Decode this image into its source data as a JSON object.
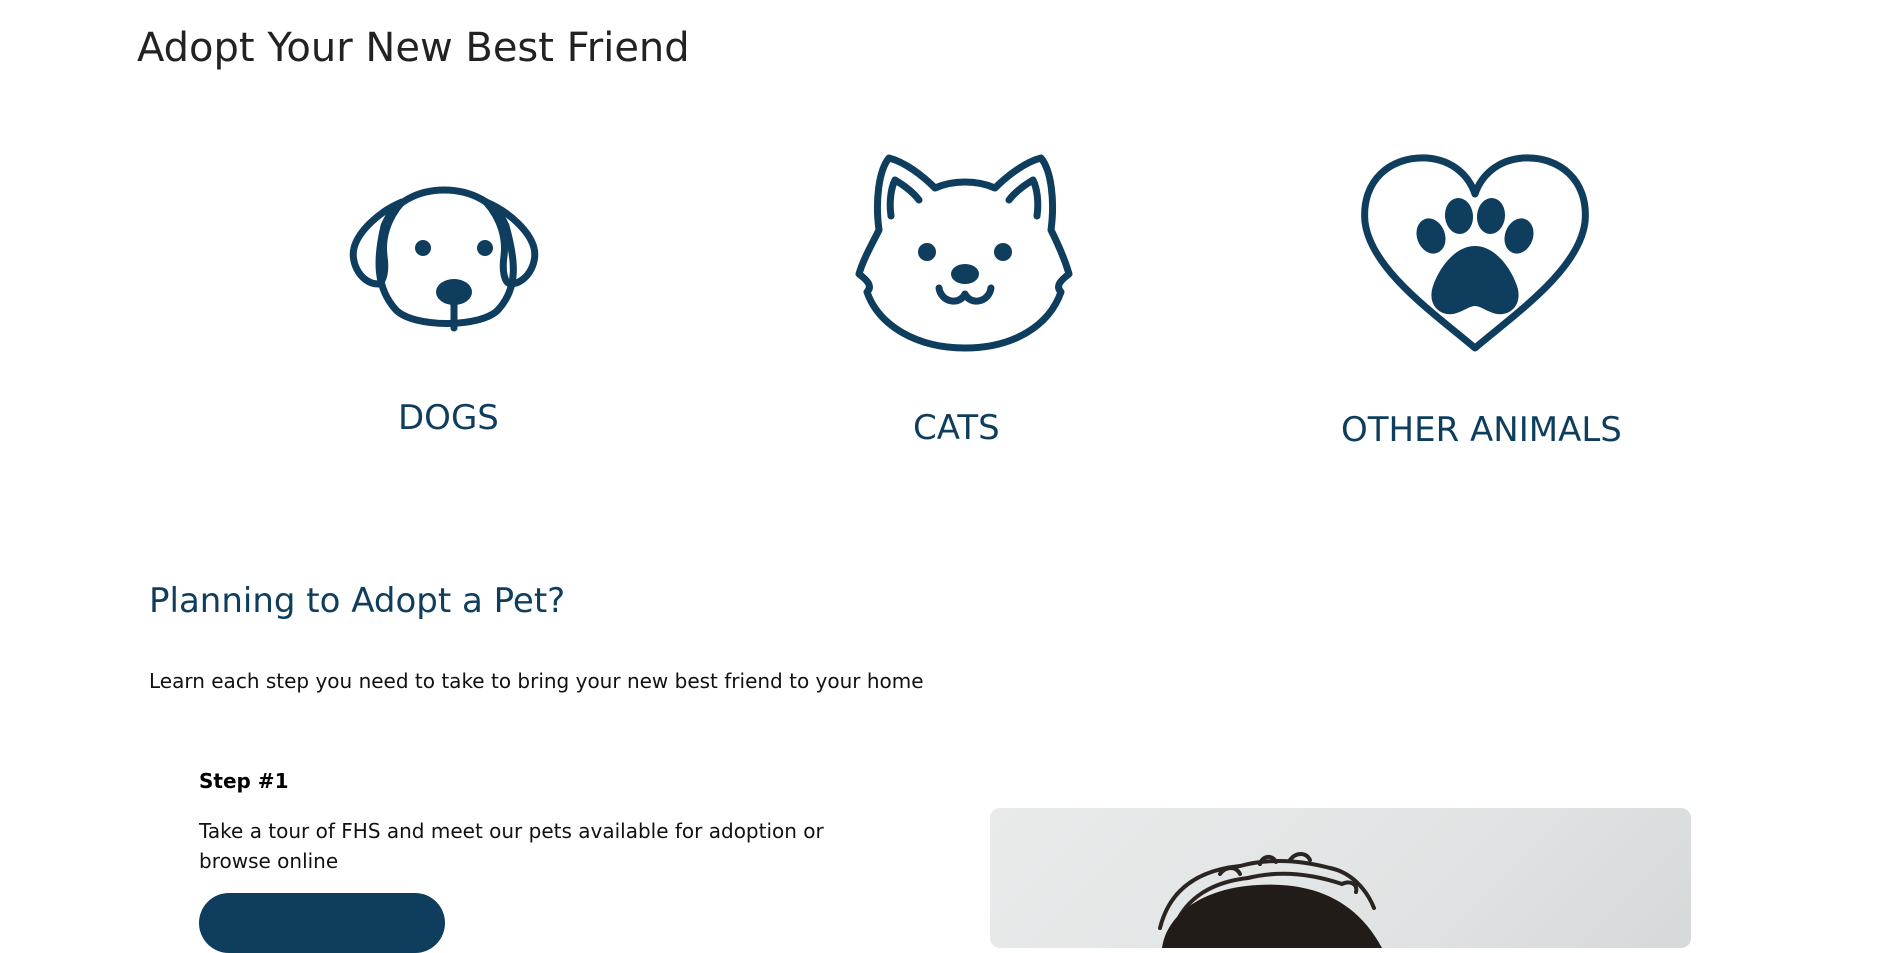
{
  "page": {
    "title": "Adopt Your New Best Friend"
  },
  "categories": [
    {
      "label": "DOGS",
      "icon": "dog-icon"
    },
    {
      "label": "CATS",
      "icon": "cat-icon"
    },
    {
      "label": "OTHER ANIMALS",
      "icon": "paw-heart-icon"
    }
  ],
  "planning": {
    "title": "Planning to Adopt a Pet?",
    "intro": "Learn each step you need to take to bring your new best friend to your home",
    "step": {
      "label": "Step #1",
      "text": "Take a tour of FHS and meet our pets available for adoption or browse online",
      "button_label": ""
    }
  },
  "colors": {
    "brand": "#0e3d5e",
    "text": "#222222",
    "background": "#ffffff"
  }
}
